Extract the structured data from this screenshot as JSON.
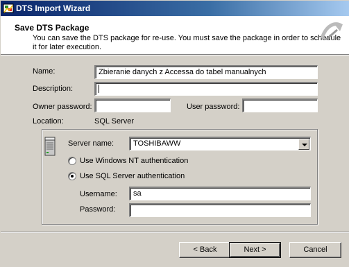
{
  "window": {
    "title": "DTS Import Wizard",
    "app_icon": "dts-wizard-icon"
  },
  "header": {
    "title": "Save DTS Package",
    "description": "You can save the DTS package for re-use.  You must save the package in order to schedule it for later execution.",
    "icon": "wizard-wand-icon"
  },
  "form": {
    "name_label": "Name:",
    "name_value": "Zbieranie danych z Accessa do tabel manualnych",
    "description_label": "Description:",
    "description_value": "",
    "owner_password_label": "Owner password:",
    "owner_password_value": "",
    "user_password_label": "User password:",
    "user_password_value": "",
    "location_label": "Location:",
    "location_value": "SQL Server"
  },
  "server": {
    "server_icon": "server-icon",
    "server_name_label": "Server name:",
    "server_name_value": "TOSHIBAWW",
    "auth_options": [
      {
        "label": "Use Windows NT authentication",
        "selected": false
      },
      {
        "label": "Use SQL Server authentication",
        "selected": true
      }
    ],
    "username_label": "Username:",
    "username_value": "sa",
    "password_label": "Password:",
    "password_value": ""
  },
  "buttons": {
    "back": "< Back",
    "next": "Next >",
    "cancel": "Cancel"
  },
  "colors": {
    "titlebar_start": "#0a246a",
    "titlebar_end": "#a6caf0",
    "face": "#d4d0c8"
  }
}
